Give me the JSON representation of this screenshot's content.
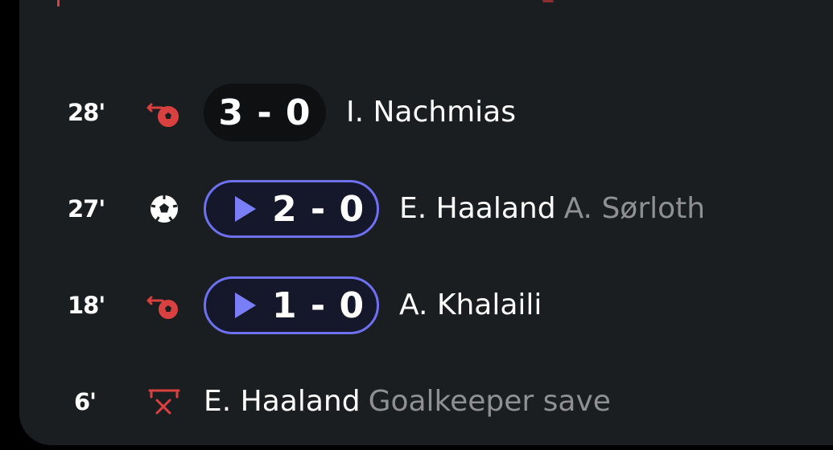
{
  "events": [
    {
      "minute": "28'",
      "icon": "own-goal-icon",
      "score": "3 - 0",
      "has_video": false,
      "player": "I. Nachmias",
      "secondary": ""
    },
    {
      "minute": "27'",
      "icon": "goal-ball-icon",
      "score": "2 - 0",
      "has_video": true,
      "player": "E. Haaland",
      "secondary": "A. Sørloth"
    },
    {
      "minute": "18'",
      "icon": "own-goal-icon",
      "score": "1 - 0",
      "has_video": true,
      "player": "A. Khalaili",
      "secondary": ""
    },
    {
      "minute": "6'",
      "icon": "missed-shot-icon",
      "score": "",
      "has_video": false,
      "player": "E. Haaland",
      "secondary": "Goalkeeper save"
    }
  ],
  "colors": {
    "card_bg": "#1b1e21",
    "score_bg": "#0f1012",
    "video_accent": "#6d71f0",
    "event_red": "#d8413f",
    "secondary_text": "#8e9094"
  }
}
